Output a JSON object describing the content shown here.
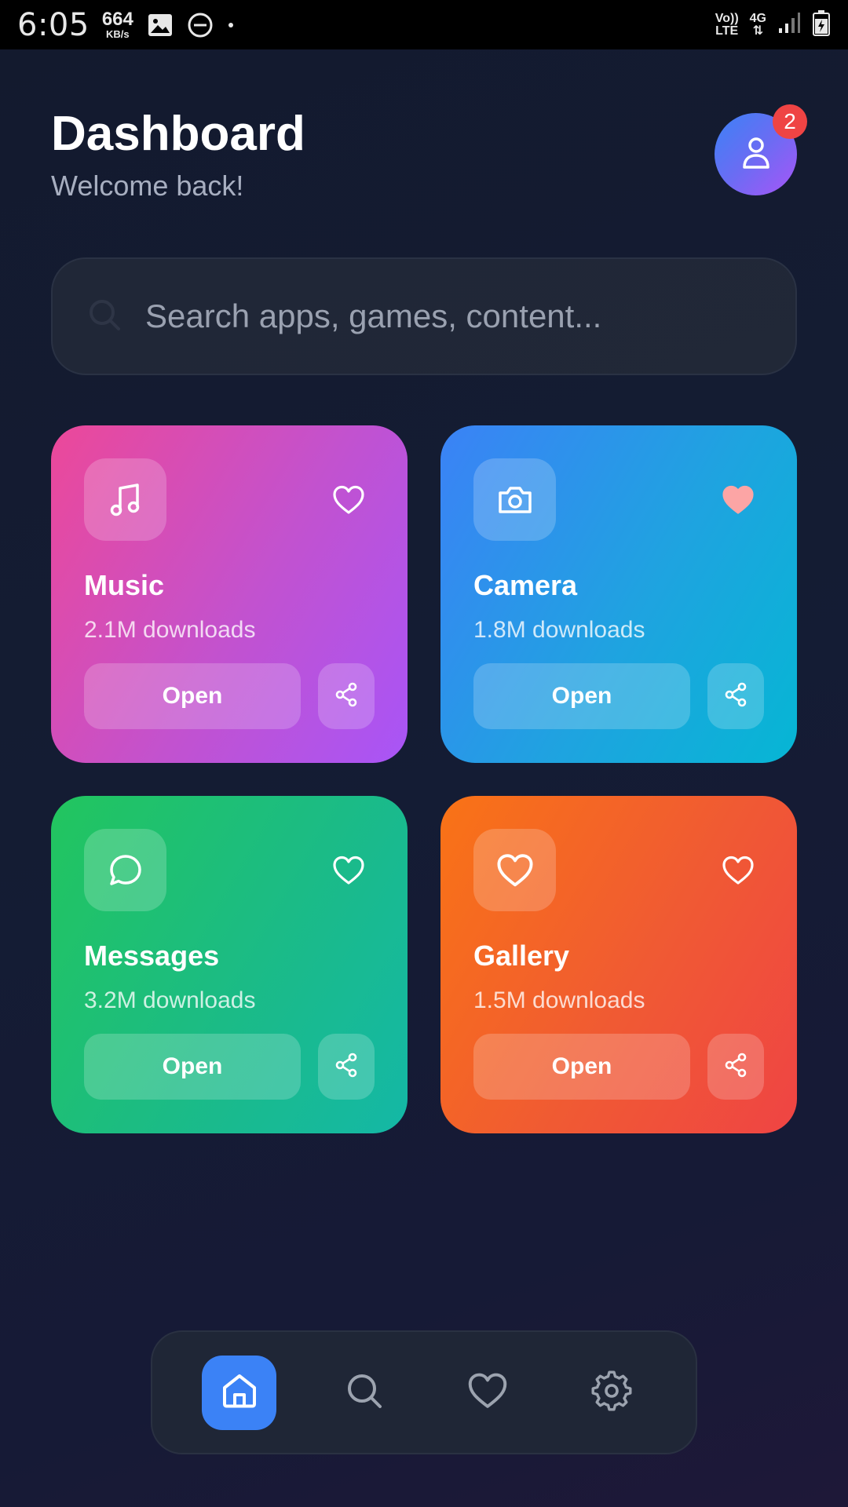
{
  "status_bar": {
    "time": "6:05",
    "net_speed_value": "664",
    "net_speed_unit": "KB/s",
    "volte_top": "Vo))",
    "volte_bottom": "LTE",
    "network": "4G"
  },
  "header": {
    "title": "Dashboard",
    "subtitle": "Welcome back!",
    "notification_count": "2"
  },
  "search": {
    "placeholder": "Search apps, games, content..."
  },
  "cards": [
    {
      "name": "Music",
      "downloads": "2.1M downloads",
      "open_label": "Open",
      "icon": "music-note-icon",
      "favorited": false
    },
    {
      "name": "Camera",
      "downloads": "1.8M downloads",
      "open_label": "Open",
      "icon": "camera-icon",
      "favorited": true
    },
    {
      "name": "Messages",
      "downloads": "3.2M downloads",
      "open_label": "Open",
      "icon": "chat-bubble-icon",
      "favorited": false
    },
    {
      "name": "Gallery",
      "downloads": "1.5M downloads",
      "open_label": "Open",
      "icon": "heart-icon",
      "favorited": false
    }
  ],
  "bottom_nav": {
    "items": [
      "home-icon",
      "search-icon",
      "heart-icon",
      "gear-icon"
    ],
    "active": "home-icon"
  },
  "colors": {
    "accent": "#3b82f6",
    "badge": "#ef4444",
    "favorite": "#fca5a5"
  }
}
